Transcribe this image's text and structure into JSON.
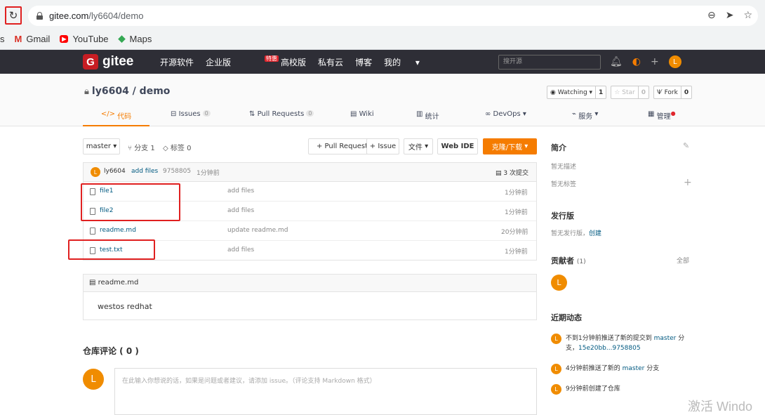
{
  "browser": {
    "url_host": "gitee.com",
    "url_path": "/ly6604/demo",
    "bookmarks": [
      {
        "label": "s",
        "icon": ""
      },
      {
        "label": "Gmail",
        "icon": "gmail-icon"
      },
      {
        "label": "YouTube",
        "icon": "youtube-icon"
      },
      {
        "label": "Maps",
        "icon": "maps-icon"
      }
    ]
  },
  "nav": {
    "logo": "gitee",
    "items": [
      "开源软件",
      "企业版",
      "高校版",
      "私有云",
      "博客",
      "我的"
    ],
    "hot_badge": "特惠",
    "search_placeholder": "搜开源",
    "avatar_letter": "L"
  },
  "repo": {
    "owner": "ly6604",
    "name": "demo",
    "full": "ly6604 / demo",
    "watching_label": "Watching",
    "watching_count": "1",
    "star_label": "Star",
    "star_count": "0",
    "fork_label": "Fork",
    "fork_count": "0"
  },
  "tabs": [
    {
      "label": "代码",
      "icon": "code-icon"
    },
    {
      "label": "Issues",
      "count": "0"
    },
    {
      "label": "Pull Requests",
      "count": "0"
    },
    {
      "label": "Wiki"
    },
    {
      "label": "统计"
    },
    {
      "label": "DevOps"
    },
    {
      "label": "服务"
    },
    {
      "label": "管理"
    }
  ],
  "toolbar": {
    "branch": "master",
    "branches": "分支 1",
    "tags": "标签 0",
    "pull_request": "+ Pull Request",
    "issue": "+ Issue",
    "file": "文件",
    "web_ide": "Web IDE",
    "clone": "克隆/下载"
  },
  "commit": {
    "author": "ly6604",
    "message": "add files",
    "hash": "9758805",
    "time": "1分钟前",
    "count": "3 次提交"
  },
  "files": [
    {
      "name": "file1",
      "message": "add files",
      "time": "1分钟前"
    },
    {
      "name": "file2",
      "message": "add files",
      "time": "1分钟前"
    },
    {
      "name": "readme.md",
      "message": "update readme.md",
      "time": "20分钟前"
    },
    {
      "name": "test.txt",
      "message": "add files",
      "time": "1分钟前"
    }
  ],
  "readme": {
    "title": "readme.md",
    "content": "westos redhat"
  },
  "comments": {
    "title": "仓库评论 ( 0 )",
    "placeholder": "在此输入你想说的话，如果是问题或者建议，请添加 issue。（评论支持 Markdown 格式）"
  },
  "sidebar": {
    "intro_title": "简介",
    "no_desc": "暂无描述",
    "no_tags": "暂无标签",
    "release_title": "发行版",
    "no_release": "暂无发行版，",
    "create": "创建",
    "contrib_title": "贡献者",
    "contrib_count": "(1)",
    "all": "全部",
    "activity_title": "近期动态",
    "activities": [
      {
        "pre": "不到1分钟前推送了新的提交到 ",
        "link": "master",
        "post": " 分支，",
        "link2": "15e20bb...9758805"
      },
      {
        "pre": "4分钟前推送了新的 ",
        "link": "master",
        "post": " 分支",
        "link2": ""
      },
      {
        "pre": "9分钟前创建了仓库",
        "link": "",
        "post": "",
        "link2": ""
      }
    ]
  },
  "watermark": "激活 Windo"
}
